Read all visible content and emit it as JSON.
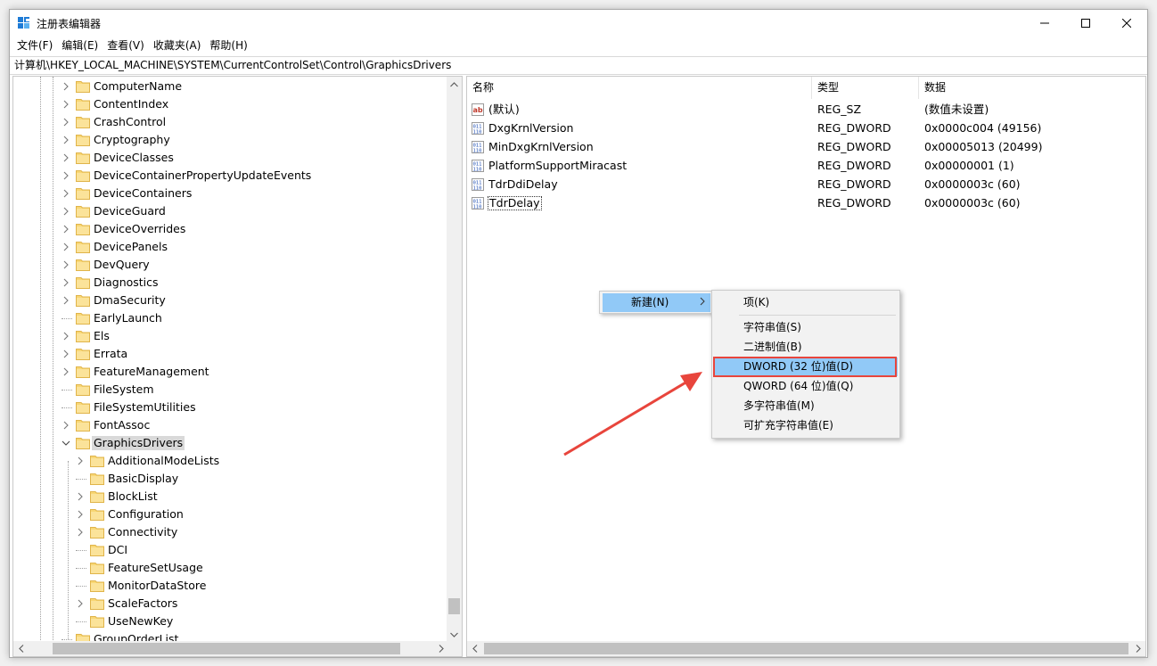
{
  "window": {
    "title": "注册表编辑器"
  },
  "window_controls": {
    "minimize": "—",
    "maximize": "☐",
    "close": "✕"
  },
  "menu": [
    "文件(F)",
    "编辑(E)",
    "查看(V)",
    "收藏夹(A)",
    "帮助(H)"
  ],
  "address": "计算机\\HKEY_LOCAL_MACHINE\\SYSTEM\\CurrentControlSet\\Control\\GraphicsDrivers",
  "tree": {
    "items": [
      {
        "label": "ComputerName",
        "expander": "collapsed",
        "level": 1
      },
      {
        "label": "ContentIndex",
        "expander": "collapsed",
        "level": 1
      },
      {
        "label": "CrashControl",
        "expander": "collapsed",
        "level": 1
      },
      {
        "label": "Cryptography",
        "expander": "collapsed",
        "level": 1
      },
      {
        "label": "DeviceClasses",
        "expander": "collapsed",
        "level": 1
      },
      {
        "label": "DeviceContainerPropertyUpdateEvents",
        "expander": "collapsed",
        "level": 1
      },
      {
        "label": "DeviceContainers",
        "expander": "collapsed",
        "level": 1
      },
      {
        "label": "DeviceGuard",
        "expander": "collapsed",
        "level": 1
      },
      {
        "label": "DeviceOverrides",
        "expander": "collapsed",
        "level": 1
      },
      {
        "label": "DevicePanels",
        "expander": "collapsed",
        "level": 1
      },
      {
        "label": "DevQuery",
        "expander": "collapsed",
        "level": 1
      },
      {
        "label": "Diagnostics",
        "expander": "collapsed",
        "level": 1
      },
      {
        "label": "DmaSecurity",
        "expander": "collapsed",
        "level": 1
      },
      {
        "label": "EarlyLaunch",
        "expander": "none",
        "level": 1
      },
      {
        "label": "Els",
        "expander": "collapsed",
        "level": 1
      },
      {
        "label": "Errata",
        "expander": "collapsed",
        "level": 1
      },
      {
        "label": "FeatureManagement",
        "expander": "collapsed",
        "level": 1
      },
      {
        "label": "FileSystem",
        "expander": "none",
        "level": 1
      },
      {
        "label": "FileSystemUtilities",
        "expander": "none",
        "level": 1
      },
      {
        "label": "FontAssoc",
        "expander": "collapsed",
        "level": 1
      },
      {
        "label": "GraphicsDrivers",
        "expander": "expanded",
        "level": 1,
        "selected": true
      },
      {
        "label": "AdditionalModeLists",
        "expander": "collapsed",
        "level": 2
      },
      {
        "label": "BasicDisplay",
        "expander": "none",
        "level": 2
      },
      {
        "label": "BlockList",
        "expander": "collapsed",
        "level": 2
      },
      {
        "label": "Configuration",
        "expander": "collapsed",
        "level": 2
      },
      {
        "label": "Connectivity",
        "expander": "collapsed",
        "level": 2
      },
      {
        "label": "DCI",
        "expander": "none",
        "level": 2
      },
      {
        "label": "FeatureSetUsage",
        "expander": "none",
        "level": 2
      },
      {
        "label": "MonitorDataStore",
        "expander": "none",
        "level": 2
      },
      {
        "label": "ScaleFactors",
        "expander": "collapsed",
        "level": 2
      },
      {
        "label": "UseNewKey",
        "expander": "none",
        "level": 2
      },
      {
        "label": "GroupOrderList",
        "expander": "none",
        "level": 1
      }
    ]
  },
  "values": {
    "columns": [
      "名称",
      "类型",
      "数据"
    ],
    "rows": [
      {
        "name": "(默认)",
        "type": "REG_SZ",
        "data": "(数值未设置)",
        "icon": "string-value-icon"
      },
      {
        "name": "DxgKrnlVersion",
        "type": "REG_DWORD",
        "data": "0x0000c004 (49156)",
        "icon": "binary-value-icon"
      },
      {
        "name": "MinDxgKrnlVersion",
        "type": "REG_DWORD",
        "data": "0x00005013 (20499)",
        "icon": "binary-value-icon"
      },
      {
        "name": "PlatformSupportMiracast",
        "type": "REG_DWORD",
        "data": "0x00000001 (1)",
        "icon": "binary-value-icon"
      },
      {
        "name": "TdrDdiDelay",
        "type": "REG_DWORD",
        "data": "0x0000003c (60)",
        "icon": "binary-value-icon"
      },
      {
        "name": "TdrDelay",
        "type": "REG_DWORD",
        "data": "0x0000003c (60)",
        "icon": "binary-value-icon",
        "focused": true
      }
    ]
  },
  "context_menu": {
    "new_label": "新建(N)",
    "submenu": {
      "key": "项(K)",
      "items": [
        "字符串值(S)",
        "二进制值(B)",
        "DWORD (32 位)值(D)",
        "QWORD (64 位)值(Q)",
        "多字符串值(M)",
        "可扩充字符串值(E)"
      ],
      "highlighted": "DWORD (32 位)值(D)"
    }
  },
  "colors": {
    "selection": "#91c9f7",
    "annotation": "#e8453c",
    "folder": "#f8d775"
  }
}
